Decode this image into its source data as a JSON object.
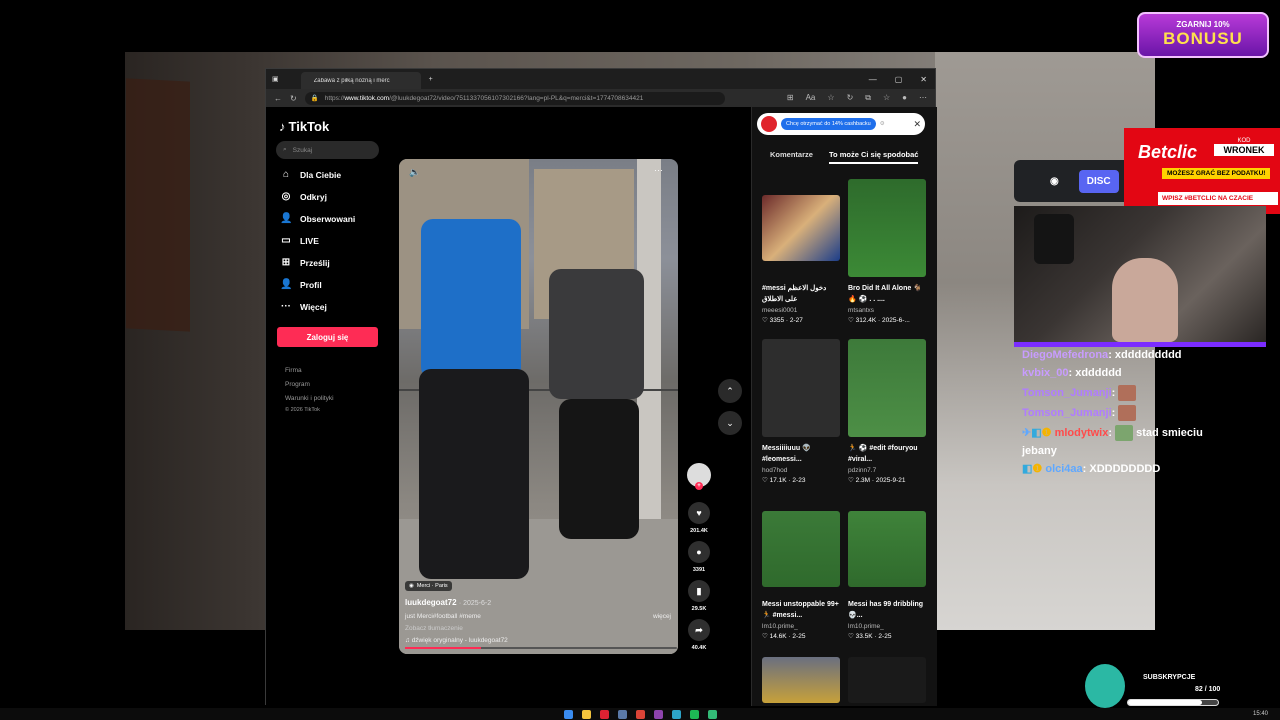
{
  "browser": {
    "tab_title": "Zabawa z piłką nożną i merc",
    "url_prefix": "https://",
    "url_domain": "www.tiktok.com",
    "url_path": "/@luukdegoat72/video/7511337056107302166?lang=pl-PL&q=merci&t=1774708634421"
  },
  "sidebar": {
    "logo": "TikTok",
    "search_placeholder": "Szukaj",
    "items": [
      {
        "label": "Dla Ciebie",
        "icon": "home-icon"
      },
      {
        "label": "Odkryj",
        "icon": "compass-icon"
      },
      {
        "label": "Obserwowani",
        "icon": "following-icon"
      },
      {
        "label": "LIVE",
        "icon": "live-icon"
      },
      {
        "label": "Prześlij",
        "icon": "upload-icon"
      },
      {
        "label": "Profil",
        "icon": "profile-icon"
      },
      {
        "label": "Więcej",
        "icon": "more-icon"
      }
    ],
    "login": "Zaloguj się",
    "footer": [
      "Firma",
      "Program",
      "Warunki i polityki",
      "© 2026 TikTok"
    ]
  },
  "video": {
    "location": "Merci · Paris",
    "username": "luukdegoat72",
    "date": "· 2025-6-2",
    "description": "just Merci#football #meme",
    "more": "więcej",
    "translate": "Zobacz tłumaczenie",
    "sound": "dźwięk oryginalny - luukdegoat72"
  },
  "actions": {
    "likes": "201.4K",
    "comments": "3391",
    "saves": "29.5K",
    "shares": "40.4K"
  },
  "panel": {
    "promo": "Chcę otrzymać do 14% cashbacku",
    "tab_comments": "Komentarze",
    "tab_related": "To może Ci się spodobać",
    "cards": [
      {
        "title": "#messi دخول الاعظم على الاطلاق",
        "user": "meeesi0001",
        "likes": "3355",
        "date": "2-27"
      },
      {
        "title": "Bro Did It All Alone 🐐 🔥 ⚽ . . ....",
        "user": "mtsantxs",
        "likes": "312.4K",
        "date": "2025-6-..."
      },
      {
        "title": "Messiiiiuuu 👽 #leomessi...",
        "user": "hod7hod",
        "likes": "17.1K",
        "date": "2-23"
      },
      {
        "title": "🏃 ⚽ #edit #fouryou #viral...",
        "user": "pdzinn7.7",
        "likes": "2.3M",
        "date": "2025-9-21"
      },
      {
        "title": "Messi unstoppable 99+ 🏃 #messi...",
        "user": "lm10.prime_",
        "likes": "14.6K",
        "date": "2-25"
      },
      {
        "title": "Messi has 99 dribbling 💀...",
        "user": "lm10.prime_",
        "likes": "33.5K",
        "date": "2-25"
      }
    ]
  },
  "stream": {
    "discord": "DISC",
    "bonus_top": "ZGARNIJ 10%",
    "bonus_bottom": "BONUSU",
    "betclic": {
      "brand": "Betclic",
      "code_label": "KOD",
      "code": "WRONEK",
      "tagline": "MOŻESZ GRAĆ BEZ PODATKU!",
      "small": "WPISZ #BETCLIC NA CZACIE"
    },
    "chat": [
      {
        "user": "DiegoMefedrona",
        "color": "#c89cff",
        "text": "xddddddddd"
      },
      {
        "user": "kvbix_00",
        "color": "#c89cff",
        "text": "xdddddd"
      },
      {
        "user": "Tomson_Jumanji",
        "color": "#b07cff",
        "text": ""
      },
      {
        "user": "Tomson_Jumanji",
        "color": "#b07cff",
        "text": ""
      },
      {
        "user": "mlodytwix",
        "color": "#ff4b4b",
        "text": "stad smieciu jebany"
      },
      {
        "user": "olci4aa",
        "color": "#5fa8ff",
        "text": "XDDDDDDDD"
      }
    ],
    "subs_label": "SUBSKRYPCJE",
    "subs_count": "82 / 100",
    "subs_progress": 0.82
  },
  "taskbar": {
    "time": "15:40"
  }
}
